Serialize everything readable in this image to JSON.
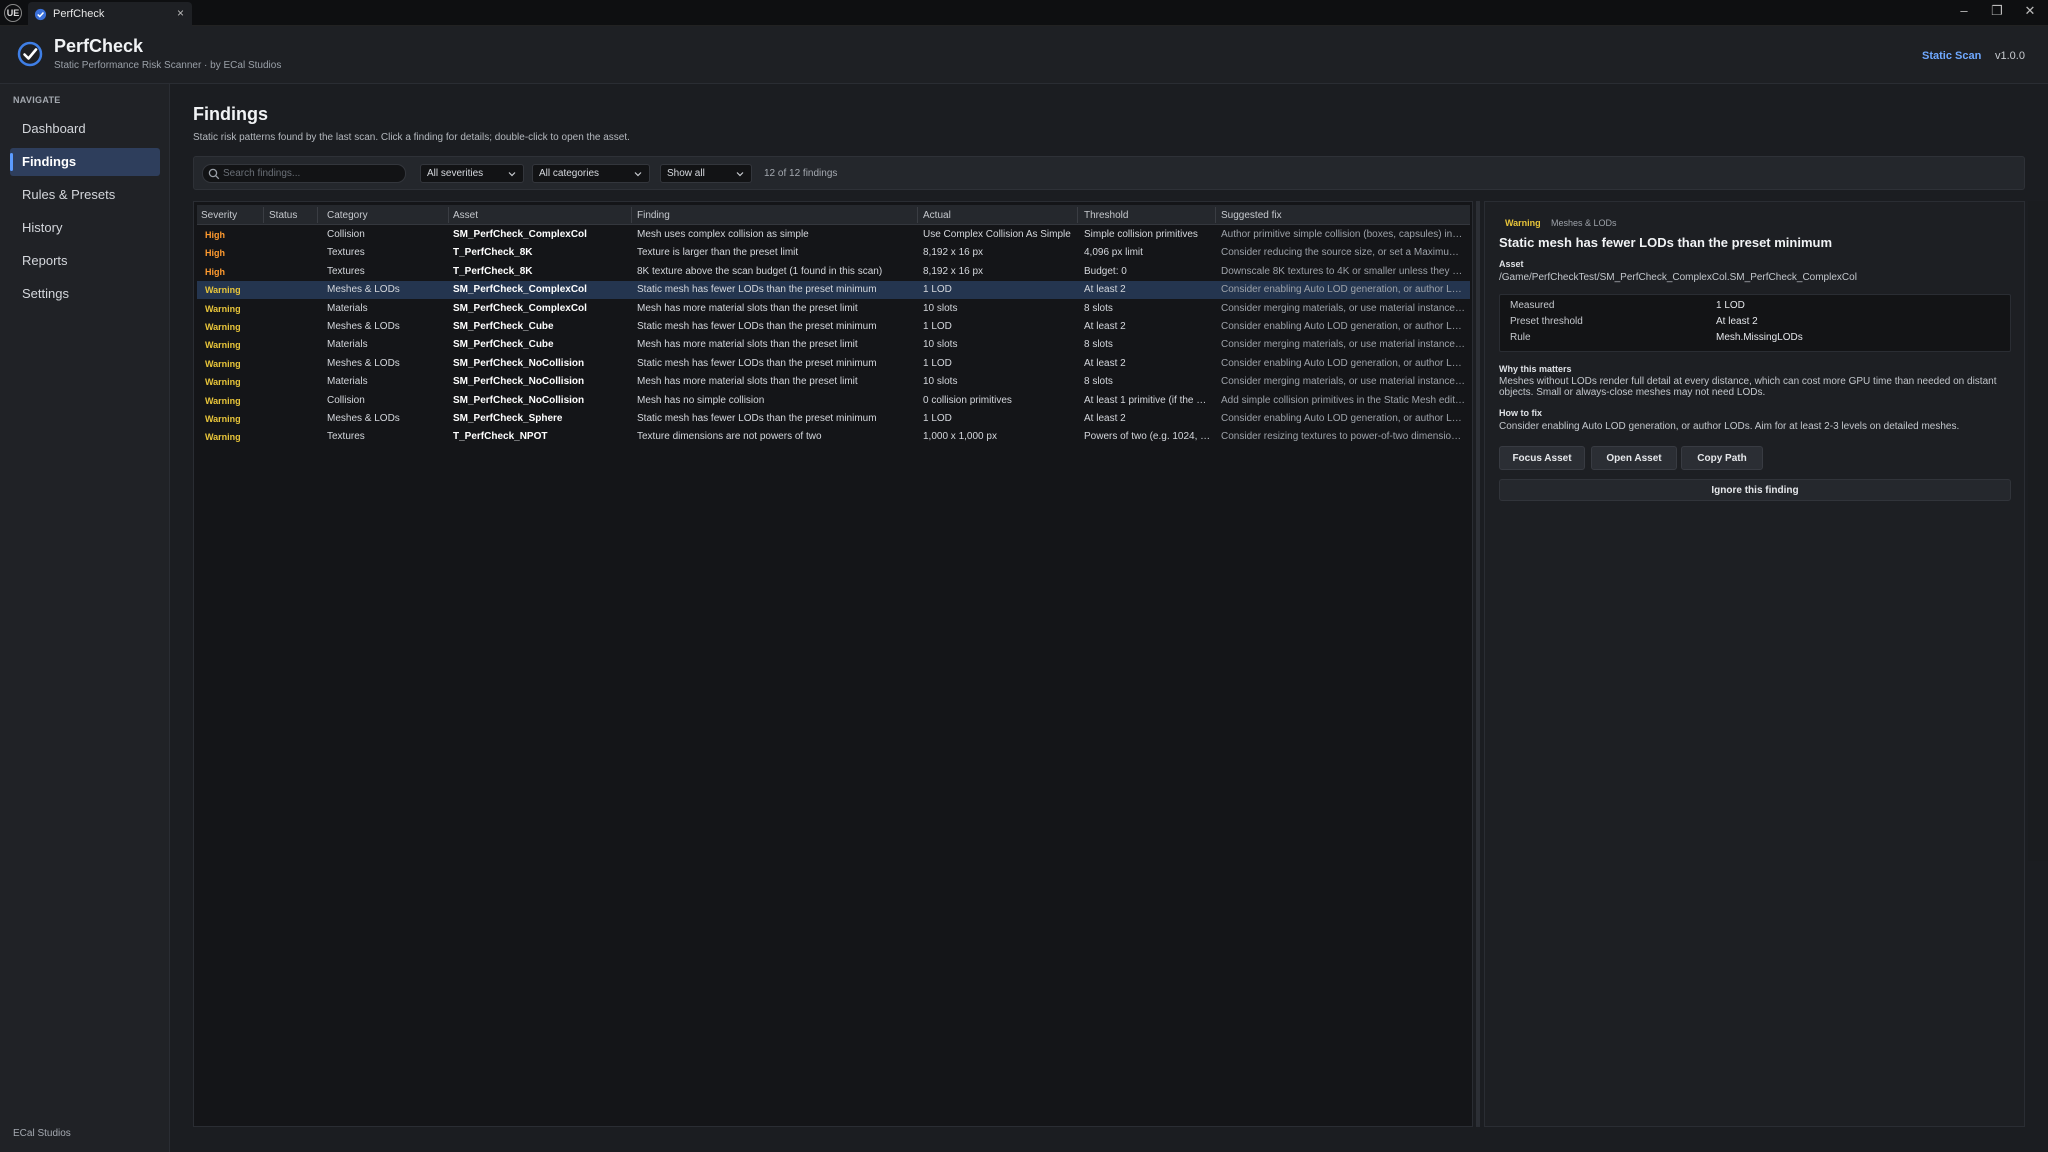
{
  "window": {
    "tab_title": "PerfCheck",
    "logo_text": "UE"
  },
  "header": {
    "app_name": "PerfCheck",
    "subtitle": "Static Performance Risk Scanner  ·  by ECal Studios",
    "scan_mode": "Static Scan",
    "version": "v1.0.0"
  },
  "sidebar": {
    "heading": "NAVIGATE",
    "items": [
      {
        "label": "Dashboard"
      },
      {
        "label": "Findings"
      },
      {
        "label": "Rules & Presets"
      },
      {
        "label": "History"
      },
      {
        "label": "Reports"
      },
      {
        "label": "Settings"
      }
    ],
    "active_index": 1,
    "footer": "ECal Studios"
  },
  "main": {
    "title": "Findings",
    "description": "Static risk patterns found by the last scan. Click a finding for details; double-click to open the asset.",
    "filters": {
      "search_placeholder": "Search findings...",
      "severity": "All severities",
      "category": "All categories",
      "show": "Show all",
      "count": "12 of 12 findings"
    }
  },
  "table": {
    "columns": [
      "Severity",
      "Status",
      "Category",
      "Asset",
      "Finding",
      "Actual",
      "Threshold",
      "Suggested fix"
    ],
    "rows": [
      {
        "severity": "High",
        "status": "",
        "category": "Collision",
        "asset": "SM_PerfCheck_ComplexCol",
        "finding": "Mesh uses complex collision as simple",
        "actual": "Use Complex Collision As Simple",
        "threshold": "Simple collision primitives",
        "fix": "Author primitive simple collision (boxes, capsules) inste..."
      },
      {
        "severity": "High",
        "status": "",
        "category": "Textures",
        "asset": "T_PerfCheck_8K",
        "finding": "Texture is larger than the preset limit",
        "actual": "8,192 x 16 px",
        "threshold": "4,096 px limit",
        "fix": "Consider reducing the source size, or set a Maximum Te..."
      },
      {
        "severity": "High",
        "status": "",
        "category": "Textures",
        "asset": "T_PerfCheck_8K",
        "finding": "8K texture above the scan budget (1 found in this scan)",
        "actual": "8,192 x 16 px",
        "threshold": "Budget: 0",
        "fix": "Downscale 8K textures to 4K or smaller unless they are..."
      },
      {
        "severity": "Warning",
        "status": "",
        "category": "Meshes & LODs",
        "asset": "SM_PerfCheck_ComplexCol",
        "finding": "Static mesh has fewer LODs than the preset minimum",
        "actual": "1 LOD",
        "threshold": "At least 2",
        "fix": "Consider enabling Auto LOD generation, or author LOD..."
      },
      {
        "severity": "Warning",
        "status": "",
        "category": "Materials",
        "asset": "SM_PerfCheck_ComplexCol",
        "finding": "Mesh has more material slots than the preset limit",
        "actual": "10 slots",
        "threshold": "8 slots",
        "fix": "Consider merging materials, or use material instances a..."
      },
      {
        "severity": "Warning",
        "status": "",
        "category": "Meshes & LODs",
        "asset": "SM_PerfCheck_Cube",
        "finding": "Static mesh has fewer LODs than the preset minimum",
        "actual": "1 LOD",
        "threshold": "At least 2",
        "fix": "Consider enabling Auto LOD generation, or author LOD..."
      },
      {
        "severity": "Warning",
        "status": "",
        "category": "Materials",
        "asset": "SM_PerfCheck_Cube",
        "finding": "Mesh has more material slots than the preset limit",
        "actual": "10 slots",
        "threshold": "8 slots",
        "fix": "Consider merging materials, or use material instances a..."
      },
      {
        "severity": "Warning",
        "status": "",
        "category": "Meshes & LODs",
        "asset": "SM_PerfCheck_NoCollision",
        "finding": "Static mesh has fewer LODs than the preset minimum",
        "actual": "1 LOD",
        "threshold": "At least 2",
        "fix": "Consider enabling Auto LOD generation, or author LOD..."
      },
      {
        "severity": "Warning",
        "status": "",
        "category": "Materials",
        "asset": "SM_PerfCheck_NoCollision",
        "finding": "Mesh has more material slots than the preset limit",
        "actual": "10 slots",
        "threshold": "8 slots",
        "fix": "Consider merging materials, or use material instances a..."
      },
      {
        "severity": "Warning",
        "status": "",
        "category": "Collision",
        "asset": "SM_PerfCheck_NoCollision",
        "finding": "Mesh has no simple collision",
        "actual": "0 collision primitives",
        "threshold": "At least 1 primitive (if the me...",
        "fix": "Add simple collision primitives in the Static Mesh editor."
      },
      {
        "severity": "Warning",
        "status": "",
        "category": "Meshes & LODs",
        "asset": "SM_PerfCheck_Sphere",
        "finding": "Static mesh has fewer LODs than the preset minimum",
        "actual": "1 LOD",
        "threshold": "At least 2",
        "fix": "Consider enabling Auto LOD generation, or author LOD..."
      },
      {
        "severity": "Warning",
        "status": "",
        "category": "Textures",
        "asset": "T_PerfCheck_NPOT",
        "finding": "Texture dimensions are not powers of two",
        "actual": "1,000 x 1,000 px",
        "threshold": "Powers of two (e.g. 1024, 20...",
        "fix": "Consider resizing textures to power-of-two dimensions..."
      }
    ],
    "selected_index": 3
  },
  "details": {
    "severity": "Warning",
    "category": "Meshes & LODs",
    "title": "Static mesh has fewer LODs than the preset minimum",
    "asset_label": "Asset",
    "asset_path": "/Game/PerfCheckTest/SM_PerfCheck_ComplexCol.SM_PerfCheck_ComplexCol",
    "metrics": [
      {
        "key": "Measured",
        "value": "1 LOD"
      },
      {
        "key": "Preset threshold",
        "value": "At least 2"
      },
      {
        "key": "Rule",
        "value": "Mesh.MissingLODs"
      }
    ],
    "why_label": "Why this matters",
    "why_text": "Meshes without LODs render full detail at every distance, which can cost more GPU time than needed on distant objects. Small or always-close meshes may not need LODs.",
    "how_label": "How to fix",
    "how_text": "Consider enabling Auto LOD generation, or author LODs. Aim for at least 2-3 levels on detailed meshes.",
    "buttons": {
      "focus": "Focus Asset",
      "open": "Open Asset",
      "copy": "Copy Path",
      "ignore": "Ignore this finding"
    }
  },
  "colors": {
    "high": "#ff9a2e",
    "warning": "#e8c53a",
    "accent": "#5b9bff",
    "selected_row": "#24354f"
  }
}
